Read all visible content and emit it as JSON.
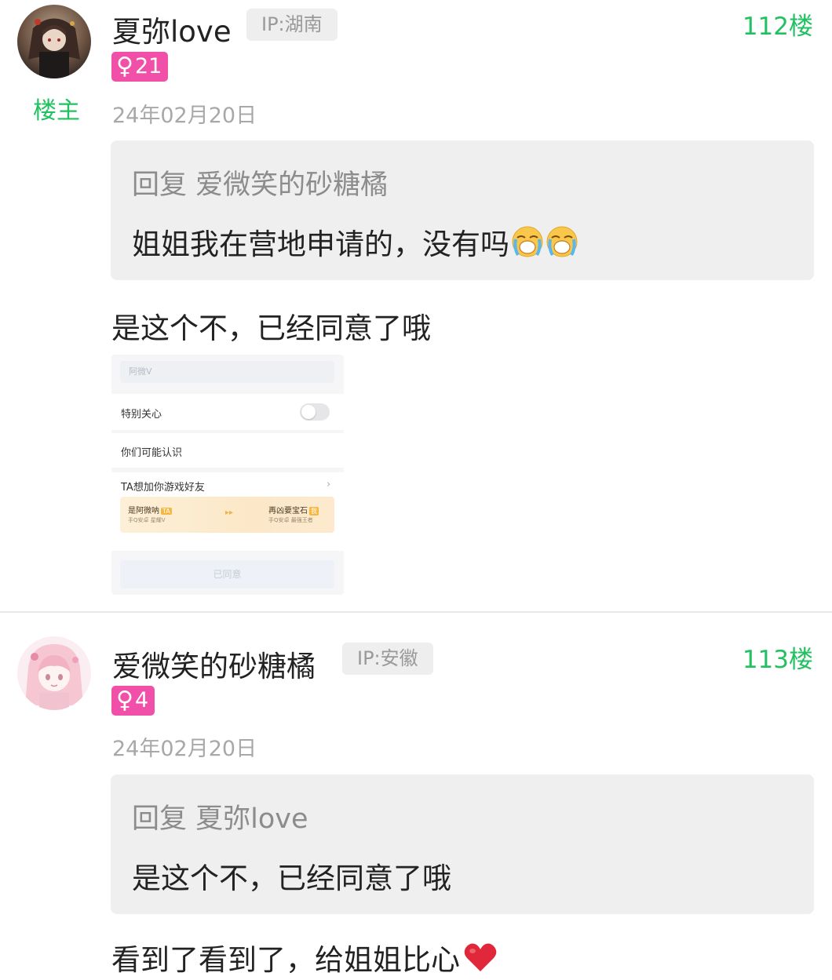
{
  "posts": [
    {
      "username": "夏弥love",
      "ip_label": "IP:湖南",
      "floor": "112楼",
      "gender_symbol": "♀",
      "level": "21",
      "op_badge": "楼主",
      "date": "24年02月20日",
      "quote": {
        "reply_prefix": "回复",
        "reply_to": "爱微笑的砂糖橘",
        "text": "姐姐我在营地申请的，没有吗",
        "emojis": [
          "loudly-crying-face-icon",
          "loudly-crying-face-icon"
        ]
      },
      "body": "是这个不，已经同意了哦",
      "attached_screenshot": {
        "search_placeholder": "阿微V",
        "special_care_label": "特别关心",
        "special_care_on": false,
        "may_know_label": "你们可能认识",
        "game_friend_label": "TA想加你游戏好友",
        "chevron": "›",
        "game_card": {
          "left_name": "是阿微呐",
          "left_tag": "TA",
          "left_sub": "手Q安卓 星耀V",
          "arrow": "▸▸",
          "right_name": "再凶要宝石",
          "right_tag": "我",
          "right_sub": "手Q安卓 最强王者"
        },
        "agreed_button": "已同意"
      }
    },
    {
      "username": "爱微笑的砂糖橘",
      "ip_label": "IP:安徽",
      "floor": "113楼",
      "gender_symbol": "♀",
      "level": "4",
      "date": "24年02月20日",
      "quote": {
        "reply_prefix": "回复",
        "reply_to": "夏弥love",
        "text": "是这个不，已经同意了哦"
      },
      "body": "看到了看到了，给姐姐比心",
      "body_emoji": "red-heart-icon"
    }
  ],
  "colors": {
    "accent_green": "#21c161",
    "gender_pink": "#f050a8",
    "quote_bg": "#efefef",
    "muted_text": "#a8a8a8"
  }
}
